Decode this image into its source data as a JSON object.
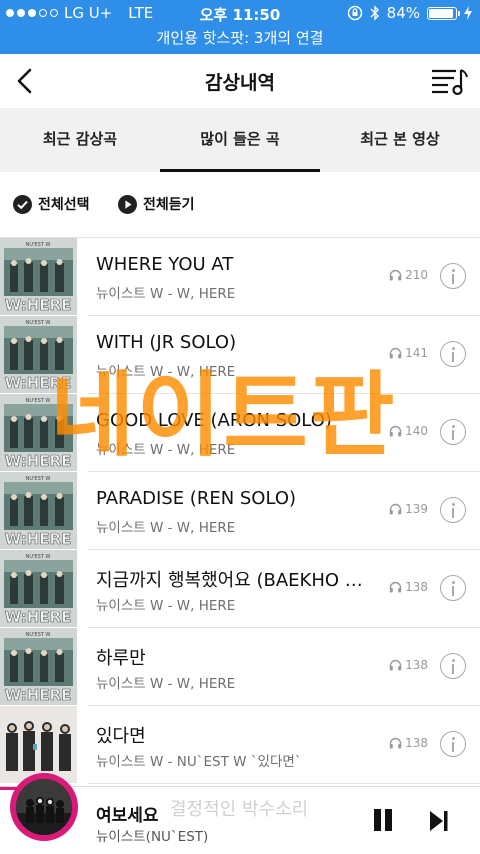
{
  "status_bar": {
    "carrier": "LG U+",
    "network": "LTE",
    "time": "오후 11:50",
    "battery": "84%",
    "battery_level": 0.84,
    "hotspot": "개인용 핫스팟: 3개의 연결"
  },
  "header": {
    "title": "감상내역",
    "back_icon": "back-chevron-icon",
    "playlist_icon": "playlist-music-icon"
  },
  "tabs": [
    {
      "label": "최근 감상곡",
      "active": false
    },
    {
      "label": "많이 들은 곡",
      "active": true
    },
    {
      "label": "최근 본 영상",
      "active": false
    }
  ],
  "select_bar": {
    "select_all": "전체선택",
    "play_all": "전체듣기"
  },
  "songs": [
    {
      "title": "WHERE YOU AT",
      "artist": "뉴이스트 W - W, HERE",
      "plays": "210"
    },
    {
      "title": "WITH (JR SOLO)",
      "artist": "뉴이스트 W - W, HERE",
      "plays": "141"
    },
    {
      "title": "GOOD LOVE (ARON SOLO)",
      "artist": "뉴이스트 W - W, HERE",
      "plays": "140"
    },
    {
      "title": "PARADISE (REN SOLO)",
      "artist": "뉴이스트 W - W, HERE",
      "plays": "139"
    },
    {
      "title": "지금까지 행복했어요 (BAEKHO SOLO)",
      "artist": "뉴이스트 W - W, HERE",
      "plays": "138"
    },
    {
      "title": "하루만",
      "artist": "뉴이스트 W - W, HERE",
      "plays": "138"
    },
    {
      "title": "있다면",
      "artist": "뉴이스트 W - NU`EST W `있다면`",
      "plays": "138"
    }
  ],
  "album_art": {
    "w_here_text": "W:HERE",
    "band_text": "NU'EST W"
  },
  "watermark": "네이트판",
  "player": {
    "title": "여보세요",
    "artist": "뉴이스트(NU`EST)",
    "behind_text": "결정적인 박수소리"
  },
  "colors": {
    "status_bar": "#2f8ee8",
    "accent": "#d91a78",
    "watermark": "#ff8c00"
  }
}
